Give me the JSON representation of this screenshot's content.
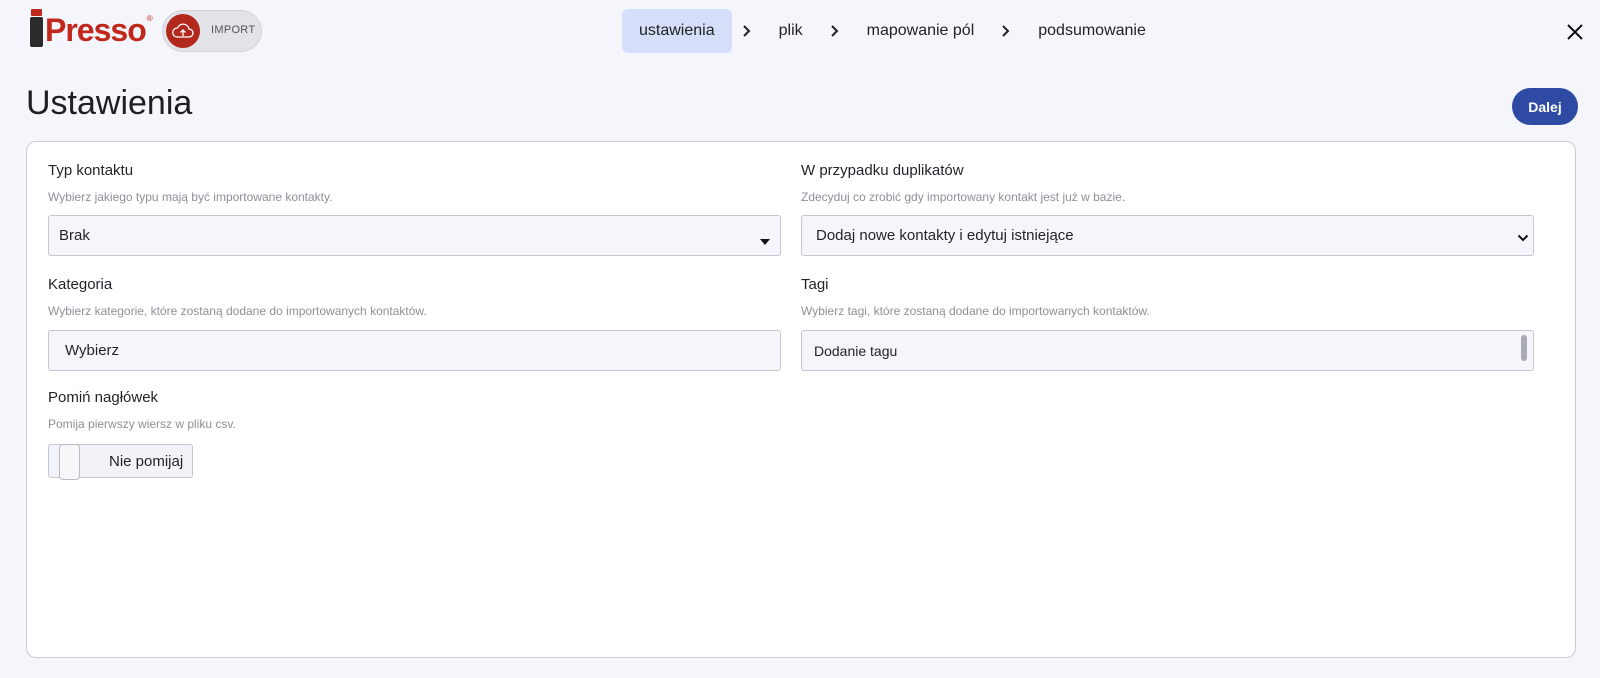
{
  "header": {
    "logo_text": "Presso",
    "logo_reg": "®",
    "import_badge": "IMPORT",
    "steps": [
      {
        "label": "ustawienia",
        "active": true
      },
      {
        "label": "plik",
        "active": false
      },
      {
        "label": "mapowanie pól",
        "active": false
      },
      {
        "label": "podsumowanie",
        "active": false
      }
    ]
  },
  "page": {
    "title": "Ustawienia",
    "next_label": "Dalej"
  },
  "form": {
    "contact_type": {
      "label": "Typ kontaktu",
      "help": "Wybierz jakiego typu mają być importowane kontakty.",
      "value": "Brak"
    },
    "duplicates": {
      "label": "W przypadku duplikatów",
      "help": "Zdecyduj co zrobić gdy importowany kontakt jest już w bazie.",
      "value": "Dodaj nowe kontakty i edytuj istniejące"
    },
    "category": {
      "label": "Kategoria",
      "help": "Wybierz kategorie, które zostaną dodane do importowanych kontaktów.",
      "placeholder": "Wybierz"
    },
    "tags": {
      "label": "Tagi",
      "help": "Wybierz tagi, które zostaną dodane do importowanych kontaktów.",
      "placeholder": "Dodanie tagu"
    },
    "skip_header": {
      "label": "Pomiń nagłówek",
      "help": "Pomija pierwszy wiersz w pliku csv.",
      "toggle_text": "Nie pomijaj",
      "enabled": false
    }
  },
  "colors": {
    "brand_red": "#c0281c",
    "primary_blue": "#2e4aa3",
    "active_step_bg": "#d6dffa",
    "page_bg": "#f5f6fc"
  }
}
